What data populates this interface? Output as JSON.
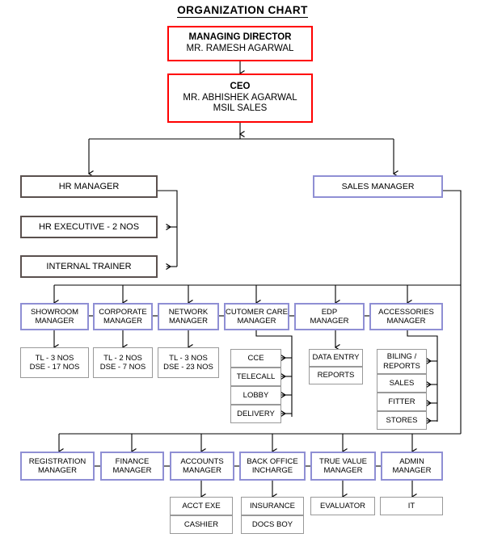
{
  "title": "ORGANIZATION CHART",
  "colors": {
    "executive_border": "#ff0000",
    "hr_border": "#5a504e",
    "manager_border": "#8f8fd4",
    "leaf_border": "#999999",
    "connector": "#000000",
    "background": "#ffffff"
  },
  "executive": {
    "managing_director": {
      "role": "MANAGING DIRECTOR",
      "name": "MR. RAMESH AGARWAL"
    },
    "ceo": {
      "role": "CEO",
      "name": "MR. ABHISHEK AGARWAL",
      "division": "MSIL SALES"
    }
  },
  "level2": {
    "hr_manager": "HR MANAGER",
    "sales_manager": "SALES MANAGER"
  },
  "hr_reports": [
    "HR EXECUTIVE - 2 NOS",
    "INTERNAL TRAINER"
  ],
  "sales_managers": [
    {
      "line1": "SHOWROOM",
      "line2": "MANAGER",
      "reports": [
        [
          "TL - 3 NOS",
          "DSE - 17 NOS"
        ]
      ]
    },
    {
      "line1": "CORPORATE",
      "line2": "MANAGER",
      "reports": [
        [
          "TL - 2 NOS",
          "DSE - 7 NOS"
        ]
      ]
    },
    {
      "line1": "NETWORK",
      "line2": "MANAGER",
      "reports": [
        [
          "TL - 3 NOS",
          "DSE - 23 NOS"
        ]
      ]
    },
    {
      "line1": "CUTOMER CARE",
      "line2": "MANAGER",
      "reports": [
        [
          "CCE"
        ],
        [
          "TELECALL"
        ],
        [
          "LOBBY"
        ],
        [
          "DELIVERY"
        ]
      ]
    },
    {
      "line1": "EDP",
      "line2": "MANAGER",
      "reports": [
        [
          "DATA ENTRY",
          "REPORTS"
        ]
      ]
    },
    {
      "line1": "ACCESSORIES",
      "line2": "MANAGER",
      "reports": [
        [
          "BILING /",
          "REPORTS"
        ],
        [
          "SALES"
        ],
        [
          "FITTER"
        ],
        [
          "STORES"
        ]
      ]
    }
  ],
  "support_managers": [
    {
      "line1": "REGISTRATION",
      "line2": "MANAGER",
      "reports": []
    },
    {
      "line1": "FINANCE",
      "line2": "MANAGER",
      "reports": []
    },
    {
      "line1": "ACCOUNTS",
      "line2": "MANAGER",
      "reports": [
        "ACCT EXE",
        "CASHIER"
      ]
    },
    {
      "line1": "BACK OFFICE",
      "line2": "INCHARGE",
      "reports": [
        "INSURANCE",
        "DOCS BOY"
      ]
    },
    {
      "line1": "TRUE VALUE",
      "line2": "MANAGER",
      "reports": [
        "EVALUATOR"
      ]
    },
    {
      "line1": "ADMIN",
      "line2": "MANAGER",
      "reports": [
        "IT"
      ]
    }
  ]
}
